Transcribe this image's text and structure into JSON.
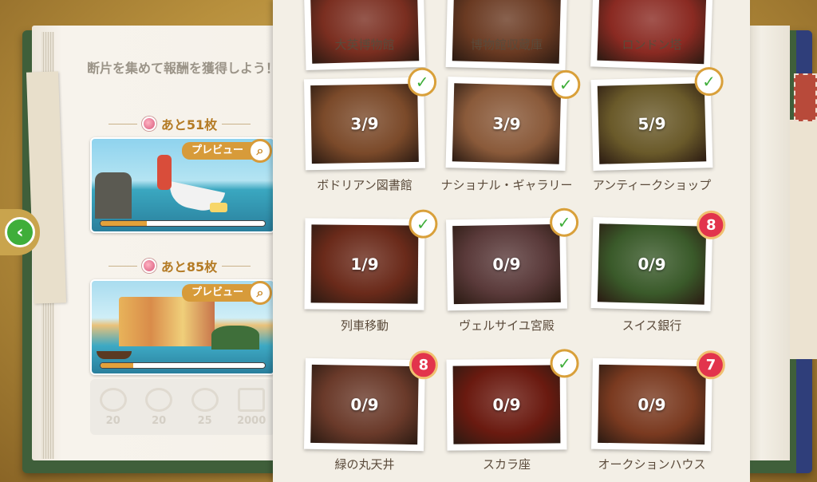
{
  "left": {
    "intro": "断片を集めて報酬を獲得しよう！",
    "events": [
      {
        "remaining": "あと51枚",
        "preview": "プレビュー",
        "progress": 0.28
      },
      {
        "remaining": "あと85枚",
        "preview": "プレビュー",
        "progress": 0.2
      }
    ],
    "rewards": [
      {
        "icon": "star-badge-icon",
        "value": "20"
      },
      {
        "icon": "star-badge-icon",
        "value": "20"
      },
      {
        "icon": "compass-icon",
        "value": "25"
      },
      {
        "icon": "gold-bar-icon",
        "value": "2000"
      }
    ]
  },
  "locations": [
    {
      "name": "大英博物館",
      "progress": "",
      "status": "none",
      "color": "#7a2e20"
    },
    {
      "name": "博物館収蔵庫",
      "progress": "",
      "status": "none",
      "color": "#6a3a22"
    },
    {
      "name": "ロンドン塔",
      "progress": "",
      "status": "none",
      "color": "#8a2a22"
    },
    {
      "name": "ボドリアン図書館",
      "progress": "3/9",
      "status": "check",
      "color": "#7b4a2a"
    },
    {
      "name": "ナショナル・ギャラリー",
      "progress": "3/9",
      "status": "check",
      "color": "#8a5a3a"
    },
    {
      "name": "アンティークショップ",
      "progress": "5/9",
      "status": "check",
      "color": "#6a5a2a"
    },
    {
      "name": "列車移動",
      "progress": "1/9",
      "status": "check",
      "color": "#6a2a1a"
    },
    {
      "name": "ヴェルサイユ宮殿",
      "progress": "0/9",
      "status": "check",
      "color": "#5a3a3a"
    },
    {
      "name": "スイス銀行",
      "progress": "0/9",
      "status": "8",
      "color": "#3a5a2a"
    },
    {
      "name": "緑の丸天井",
      "progress": "0/9",
      "status": "8",
      "color": "#6a3a2a"
    },
    {
      "name": "スカラ座",
      "progress": "0/9",
      "status": "check",
      "color": "#6a1a10"
    },
    {
      "name": "オークションハウス",
      "progress": "0/9",
      "status": "7",
      "color": "#7a3a20"
    }
  ],
  "colors": {
    "accent": "#d79b3a",
    "check": "#3fae3a",
    "badge": "#e2344c"
  }
}
